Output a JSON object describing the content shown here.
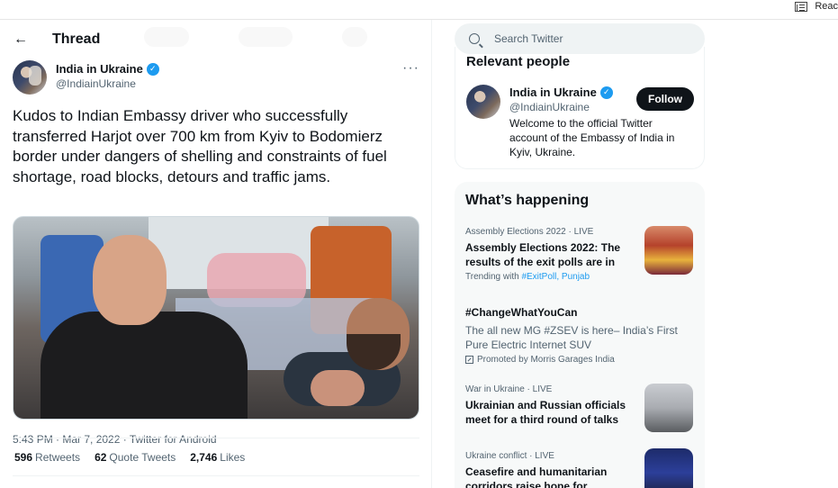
{
  "browser": {
    "reader_label": "Reac"
  },
  "header": {
    "title": "Thread"
  },
  "tweet": {
    "author_name": "India in Ukraine",
    "author_handle": "@IndiainUkraine",
    "more": "···",
    "text": "Kudos to Indian Embassy driver who successfully transferred Harjot over 700 km from Kyiv to Bodomierz border under dangers of shelling and constraints of fuel shortage, road blocks, detours and traffic jams.",
    "timestamp": "5:43 PM · Mar 7, 2022 · Twitter for Android",
    "stats": {
      "retweets_count": "596",
      "retweets_label": "Retweets",
      "quotes_count": "62",
      "quotes_label": "Quote Tweets",
      "likes_count": "2,746",
      "likes_label": "Likes"
    }
  },
  "search": {
    "placeholder": "Search Twitter"
  },
  "relevant": {
    "title": "Relevant people",
    "name": "India in Ukraine",
    "handle": "@IndiainUkraine",
    "follow_label": "Follow",
    "bio": "Welcome to the official Twitter account of the Embassy of India in Kyiv, Ukraine."
  },
  "happening": {
    "title": "What’s happening",
    "trends": [
      {
        "context": "Assembly Elections 2022 · LIVE",
        "headline": "Assembly Elections 2022: The results of the exit polls are in",
        "sub_prefix": "Trending with",
        "sub_links": "#ExitPoll, Punjab"
      },
      {
        "headline": "#ChangeWhatYouCan",
        "description": "The all new MG #ZSEV is here– India’s First Pure Electric Internet SUV",
        "promoted": "Promoted by Morris Garages India"
      },
      {
        "context": "War in Ukraine · LIVE",
        "headline": "Ukrainian and Russian officials meet for a third round of talks"
      },
      {
        "context": "Ukraine conflict · LIVE",
        "headline": "Ceasefire and humanitarian corridors raise hope for"
      }
    ]
  },
  "colors": {
    "accent": "#1d9bf0",
    "text": "#0f1419",
    "muted": "#536471"
  }
}
